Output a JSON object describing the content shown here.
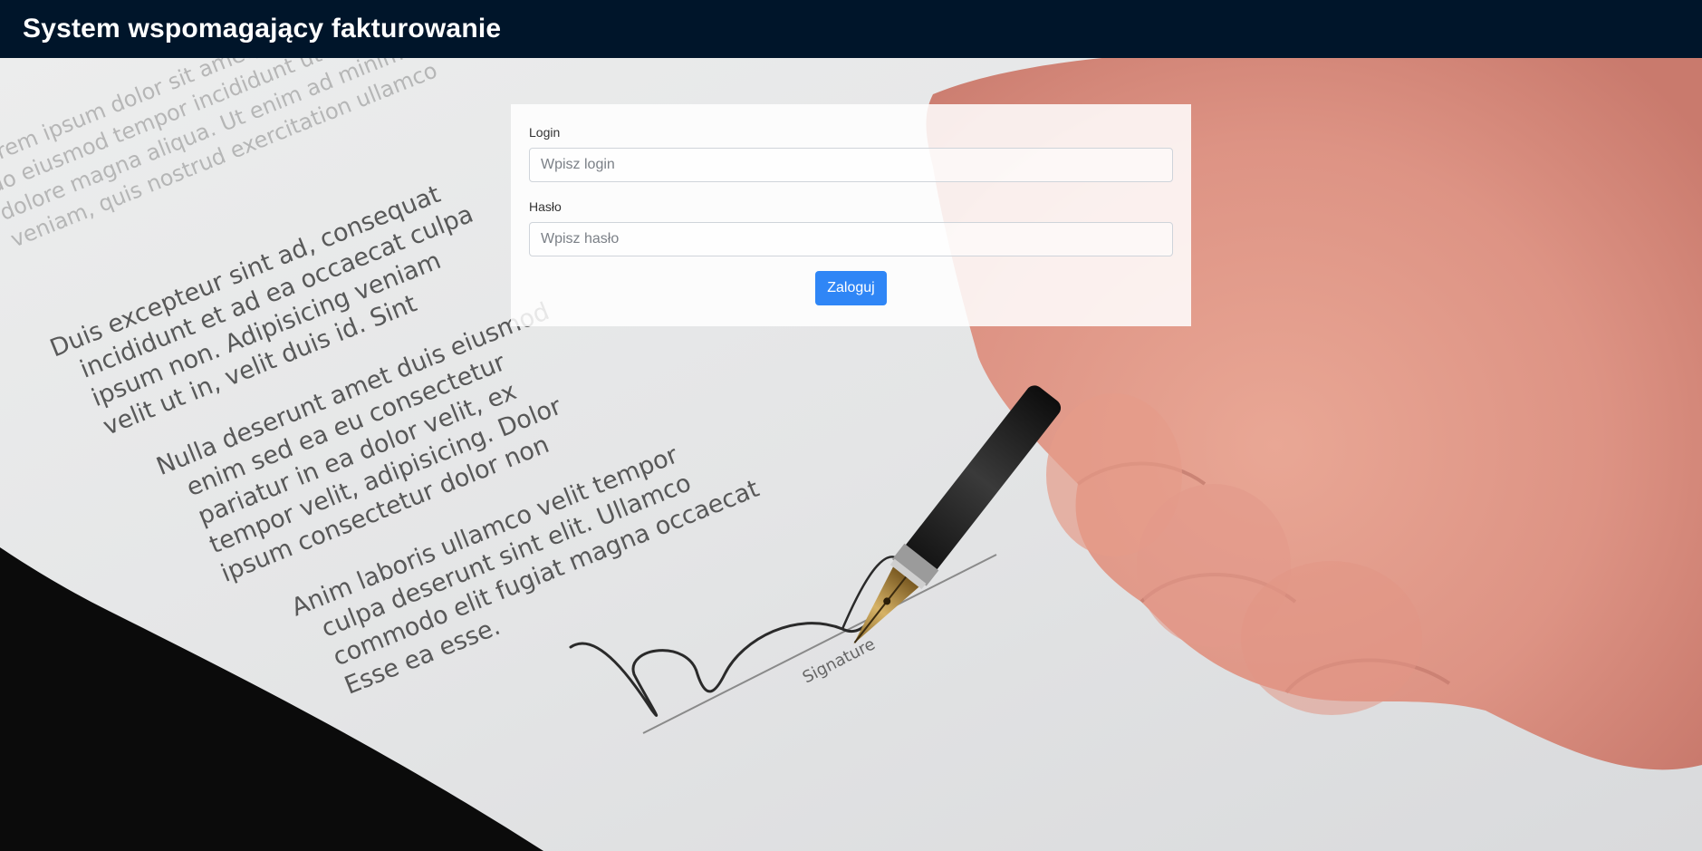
{
  "header": {
    "title": "System wspomagający fakturowanie"
  },
  "login_form": {
    "login_label": "Login",
    "login_placeholder": "Wpisz login",
    "login_value": "",
    "password_label": "Hasło",
    "password_placeholder": "Wpisz hasło",
    "password_value": "",
    "submit_label": "Zaloguj"
  },
  "background": {
    "icon": "signing-document-photo",
    "text_lines": [
      "Duis excepteur sint ad, consequat",
      "incididunt et ad ea occaecat culpa",
      "ipsum non. Adipisicing veniam",
      "velit ut in, velit duis id. Sint",
      "Nulla deserunt amet duis eiusmod",
      "enim sed ea eu consectetur",
      "pariatur in ea dolor velit, ex",
      "tempor velit, adipisicing. Dolor",
      "ipsum consectetur dolor non",
      "Anim laboris ullamco velit tempor",
      "culpa deserunt sint elit. Ullamco",
      "commodo elit fugiat magna occaecat",
      "Esse ea esse.",
      "Signature"
    ]
  },
  "colors": {
    "header_bg": "#00152a",
    "primary_button": "#2f86f6"
  }
}
